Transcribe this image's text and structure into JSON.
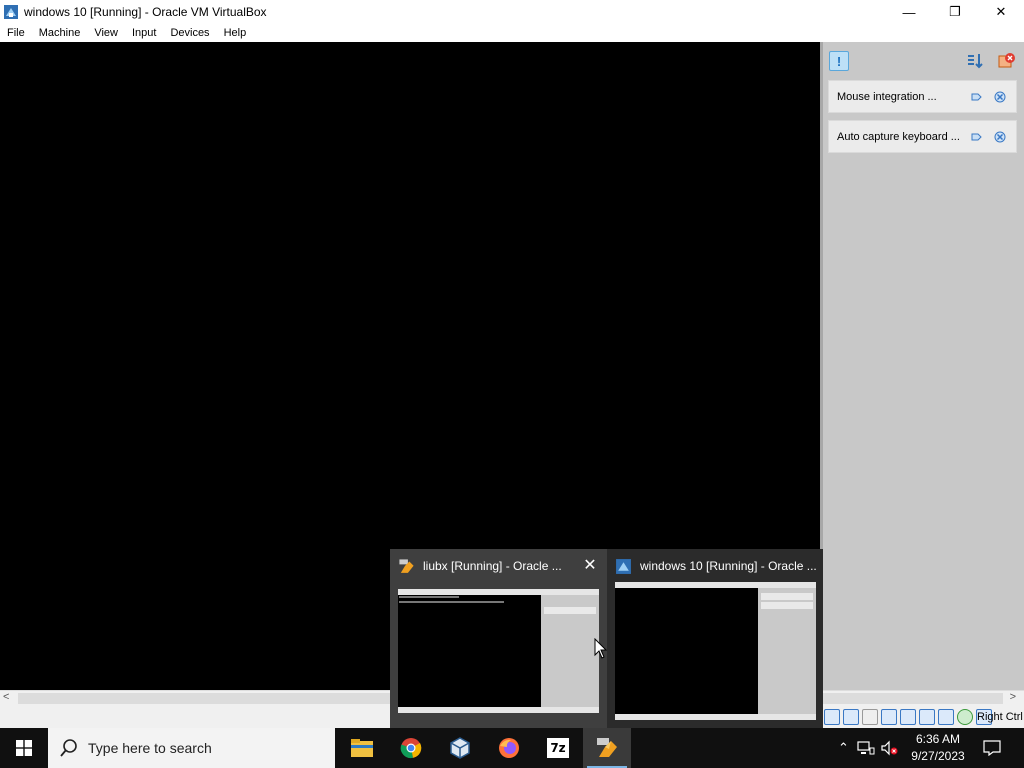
{
  "window": {
    "title": "windows 10 [Running] - Oracle VM VirtualBox",
    "minimize_glyph": "—",
    "restore_glyph": "❐",
    "close_glyph": "✕"
  },
  "menu": [
    "File",
    "Machine",
    "View",
    "Input",
    "Devices",
    "Help"
  ],
  "notifications": {
    "items": [
      {
        "text": "Mouse integration ..."
      },
      {
        "text": "Auto capture keyboard ..."
      }
    ]
  },
  "statusbar": {
    "host_key": "Right Ctrl",
    "icons": [
      "hard-disk-icon",
      "optical-drive-icon",
      "audio-icon",
      "network-icon",
      "usb-icon",
      "shared-folders-icon",
      "display-icon",
      "recording-icon",
      "cpu-icon",
      "mouse-integration-icon"
    ]
  },
  "preview": {
    "cards": [
      {
        "title": "liubx [Running] - Oracle ...",
        "close_glyph": "✕"
      },
      {
        "title": "windows 10 [Running] - Oracle ..."
      }
    ]
  },
  "taskbar": {
    "search_placeholder": "Type here to search",
    "apps": [
      "file-explorer-icon",
      "chrome-icon",
      "virtualbox-icon",
      "firefox-icon",
      "7zip-icon",
      "virtualbox-vm-icon"
    ],
    "sevenzip_label": "7z",
    "clock": {
      "time": "6:36 AM",
      "date": "9/27/2023"
    }
  },
  "colors": {
    "taskbar": "#101010",
    "accent": "#7cb6e6",
    "panel": "#c8c8c8"
  }
}
